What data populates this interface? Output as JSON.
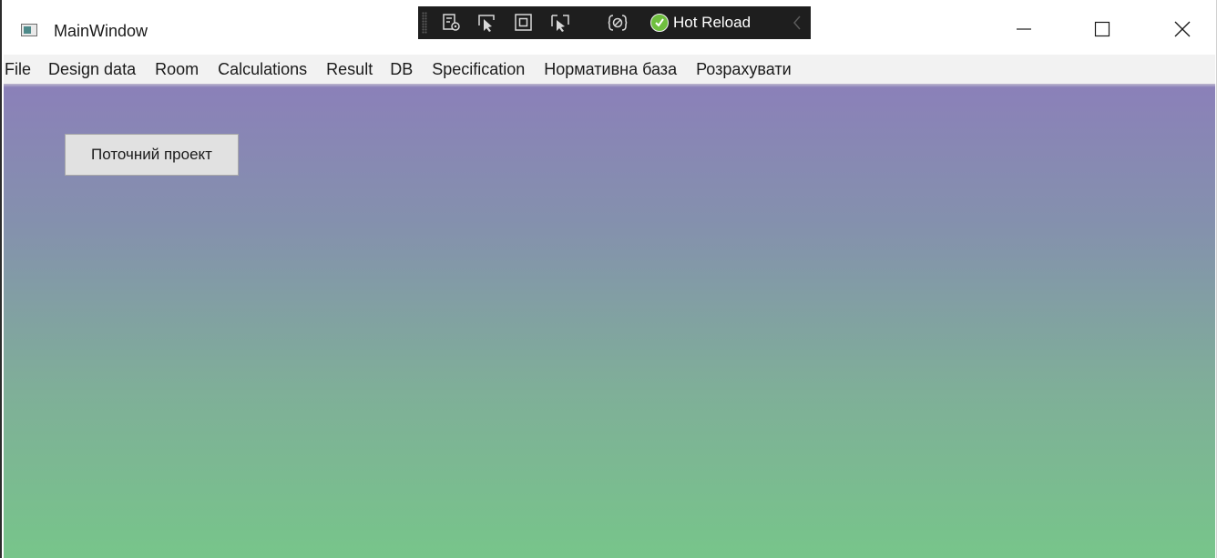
{
  "window": {
    "title": "MainWindow"
  },
  "debug_toolbar": {
    "hot_reload_label": "Hot Reload",
    "icons": [
      "live-visual-tree-icon",
      "select-element-icon",
      "display-layout-adorners-icon",
      "track-focused-element-icon",
      "binding-failures-icon",
      "hot-reload-status-icon",
      "collapse-chevron-icon"
    ],
    "accent": "#6fbf3f"
  },
  "menu": {
    "items": [
      "File",
      "Design data",
      "Room",
      "Calculations",
      "Result",
      "DB",
      "Specification",
      "Нормативна база",
      "Розрахувати"
    ]
  },
  "content": {
    "current_project_button": "Поточний проект",
    "gradient_top": "#8b80b9",
    "gradient_bottom": "#77c58a"
  }
}
